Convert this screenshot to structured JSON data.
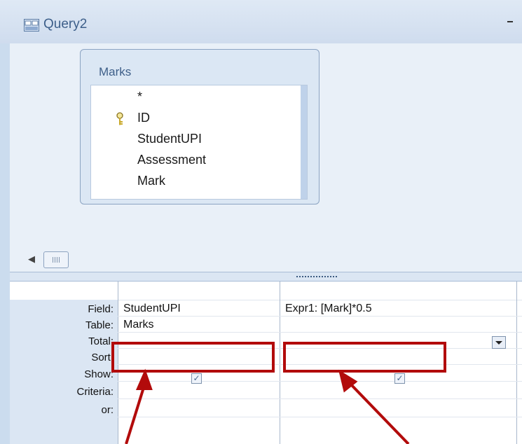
{
  "window": {
    "title": "Query2",
    "minimize_glyph": "-"
  },
  "table": {
    "name": "Marks",
    "fields": [
      "*",
      "ID",
      "StudentUPI",
      "Assessment",
      "Mark"
    ],
    "key_field": "ID"
  },
  "design_grid": {
    "row_labels": [
      "Field:",
      "Table:",
      "Total:",
      "Sort:",
      "Show:",
      "Criteria:",
      "or:"
    ],
    "columns": [
      {
        "field": "StudentUPI",
        "table": "Marks",
        "total": "",
        "sort": "",
        "show": true,
        "criteria": "",
        "or": ""
      },
      {
        "field": "Expr1: [Mark]*0.5",
        "table": "",
        "total": "",
        "sort": "",
        "show": true,
        "criteria": "",
        "or": ""
      }
    ]
  },
  "annotation": {
    "highlight_color": "#b20b0b"
  },
  "icons": [
    "query-icon",
    "key-icon",
    "left-arrow-icon",
    "scroll-thumb",
    "splitter-grip",
    "dropdown-arrow-icon",
    "checkmark-icon"
  ]
}
